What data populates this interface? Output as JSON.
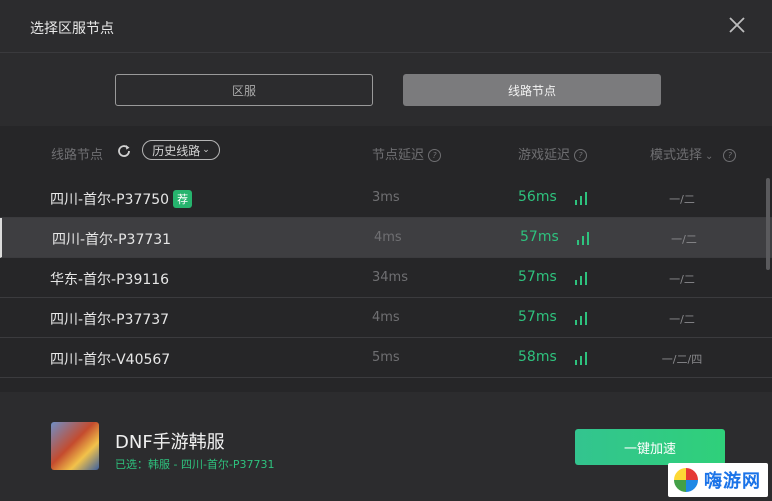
{
  "header": {
    "title": "选择区服节点"
  },
  "tabs": [
    {
      "label": "区服",
      "active": false
    },
    {
      "label": "线路节点",
      "active": true
    }
  ],
  "columns": {
    "route": "线路节点",
    "history": "历史线路",
    "node_latency": "节点延迟",
    "game_latency": "游戏延迟",
    "mode": "模式选择"
  },
  "rows": [
    {
      "name": "四川-首尔-P37750",
      "badge": "荐",
      "node_latency": "3ms",
      "game_latency": "56ms",
      "mode": "一/二",
      "selected": false
    },
    {
      "name": "四川-首尔-P37731",
      "badge": "",
      "node_latency": "4ms",
      "game_latency": "57ms",
      "mode": "一/二",
      "selected": true
    },
    {
      "name": "华东-首尔-P39116",
      "badge": "",
      "node_latency": "34ms",
      "game_latency": "57ms",
      "mode": "一/二",
      "selected": false
    },
    {
      "name": "四川-首尔-P37737",
      "badge": "",
      "node_latency": "4ms",
      "game_latency": "57ms",
      "mode": "一/二",
      "selected": false
    },
    {
      "name": "四川-首尔-V40567",
      "badge": "",
      "node_latency": "5ms",
      "game_latency": "58ms",
      "mode": "一/二/四",
      "selected": false
    }
  ],
  "footer": {
    "game_name": "DNF手游韩服",
    "selected_text": "已选：韩服 - 四川-首尔-P37731",
    "speed_button": "一键加速"
  },
  "watermark": {
    "text": "嗨游网"
  },
  "colors": {
    "accent_green": "#2ec27e",
    "button_green": "#33c48f",
    "background": "#2c2c2e"
  }
}
